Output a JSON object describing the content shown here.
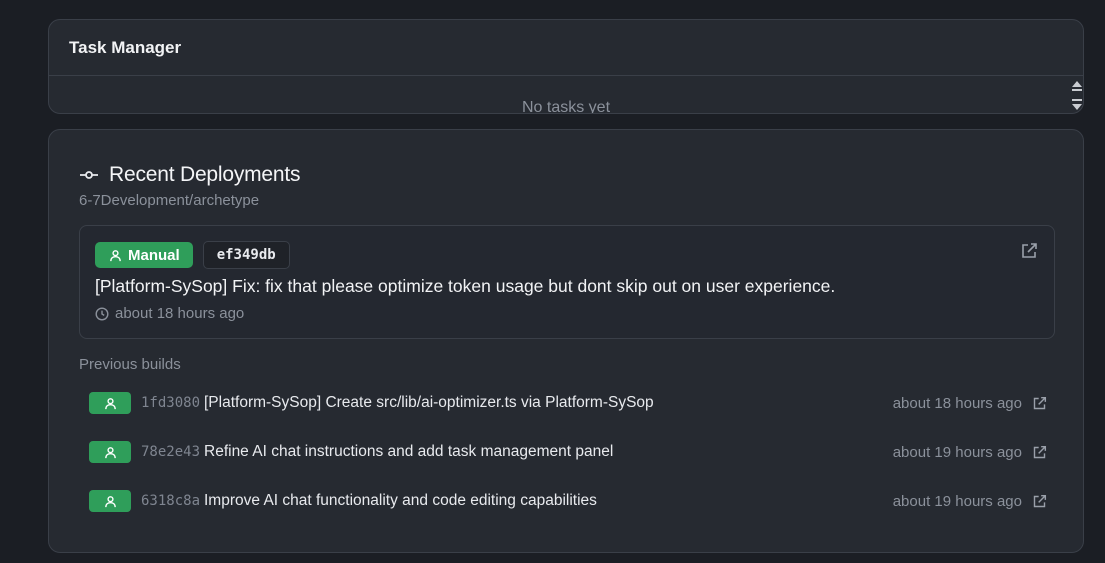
{
  "task_manager": {
    "title": "Task Manager",
    "empty_text": "No tasks yet"
  },
  "deployments": {
    "title": "Recent Deployments",
    "repo": "6-7Development/archetype",
    "latest": {
      "badge": "Manual",
      "hash": "ef349db",
      "message": "[Platform-SySop] Fix: fix that please optimize token usage but dont skip out on user experience.",
      "time": "about 18 hours ago"
    },
    "previous_label": "Previous builds",
    "builds": [
      {
        "hash": "1fd3080",
        "message": "[Platform-SySop] Create src/lib/ai-optimizer.ts via Platform-SySop",
        "time": "about 18 hours ago"
      },
      {
        "hash": "78e2e43",
        "message": "Refine AI chat instructions and add task management panel",
        "time": "about 19 hours ago"
      },
      {
        "hash": "6318c8a",
        "message": "Improve AI chat functionality and code editing capabilities",
        "time": "about 19 hours ago"
      }
    ]
  },
  "colors": {
    "background": "#1b1e24",
    "card": "#262a31",
    "success": "#2f9e5a",
    "muted": "#8b919b"
  },
  "icons": {
    "commit": "git-commit-icon",
    "user": "user-icon",
    "external": "external-link-icon",
    "clock": "clock-icon"
  }
}
